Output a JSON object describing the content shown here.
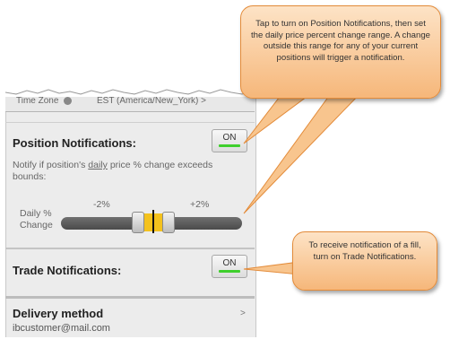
{
  "timezone_row": {
    "left_text": "Time Zone",
    "right_text": "EST (America/New_York) >"
  },
  "position_notifications": {
    "label": "Position Notifications:",
    "toggle_label": "ON",
    "description_prefix": "Notify if position's ",
    "description_emphasis": "daily",
    "description_suffix": " price % change exceeds bounds:",
    "daily_change_label_line1": "Daily %",
    "daily_change_label_line2": "Change",
    "low_bound": "-2%",
    "high_bound": "+2%",
    "range_percent": [
      -2,
      2
    ]
  },
  "trade_notifications": {
    "label": "Trade Notifications:",
    "toggle_label": "ON"
  },
  "delivery": {
    "label": "Delivery method",
    "value": "ibcustomer@mail.com",
    "chevron": ">"
  },
  "callouts": {
    "position_help": "Tap to turn on Position Notifications, then set the daily price percent change range. A change outside this range for any of your current positions will trigger a notification.",
    "trade_help": "To receive notification of a fill, turn on Trade Notifications."
  },
  "colors": {
    "toggle_on": "#3ecf2c",
    "callout_fill": "#f6b77a",
    "callout_border": "#e38b39",
    "range_band": "#f4c21d"
  }
}
